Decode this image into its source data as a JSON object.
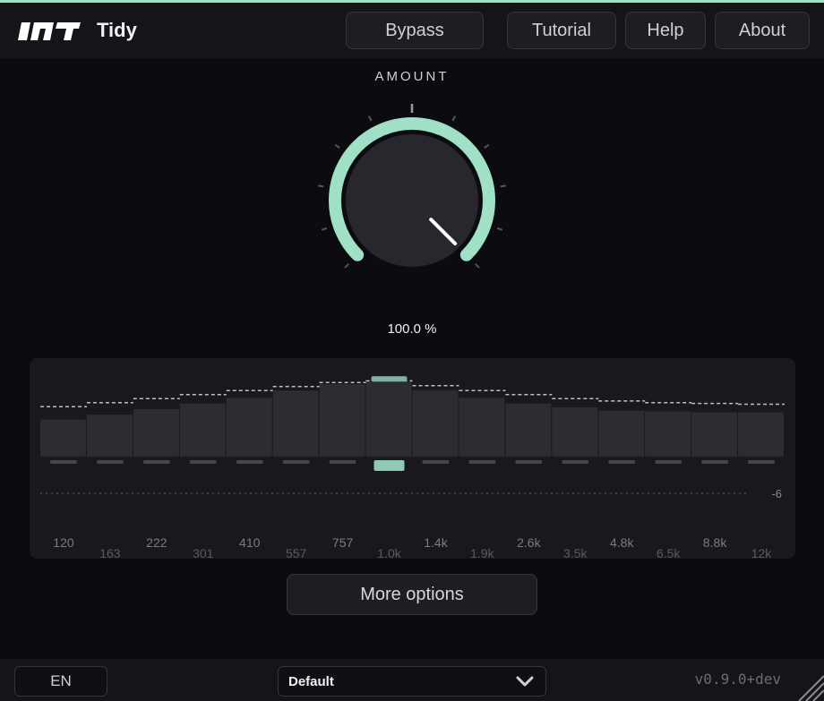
{
  "app": {
    "title": "Tidy",
    "brand_logo_text": "INT",
    "accent_color": "#9fe0c6"
  },
  "header": {
    "buttons": [
      {
        "label": "Bypass"
      },
      {
        "label": "Tutorial"
      },
      {
        "label": "Help"
      },
      {
        "label": "About"
      }
    ]
  },
  "amount": {
    "label": "AMOUNT",
    "value_text": "100.0 %",
    "value_percent": 100
  },
  "eq": {
    "level_label": "-6",
    "band_labels_top": [
      "120",
      "222",
      "410",
      "757",
      "1.4k",
      "2.6k",
      "4.8k",
      "8.8k"
    ],
    "band_labels_bottom": [
      "163",
      "301",
      "557",
      "1.0k",
      "1.9k",
      "3.5k",
      "6.5k",
      "12k"
    ],
    "band_levels": [
      0.46,
      0.52,
      0.59,
      0.66,
      0.73,
      0.82,
      0.9,
      0.93,
      0.82,
      0.73,
      0.66,
      0.61,
      0.57,
      0.56,
      0.55,
      0.55
    ],
    "band_targets": [
      0.62,
      0.67,
      0.72,
      0.77,
      0.82,
      0.87,
      0.92,
      0.94,
      0.88,
      0.82,
      0.77,
      0.72,
      0.69,
      0.67,
      0.66,
      0.65
    ],
    "selected_band": 7
  },
  "more_options": {
    "label": "More options"
  },
  "footer": {
    "language": "EN",
    "preset": "Default",
    "version": "v0.9.0+dev"
  }
}
